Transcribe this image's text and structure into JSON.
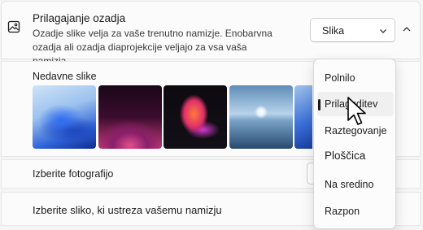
{
  "header": {
    "title": "Prilagajanje ozadja",
    "description": "Ozadje slike velja za vaše trenutno namizje. Enobarvna ozadja ali ozadja diaprojekcije veljajo za vsa vaša namizja.",
    "icon": "image-icon",
    "dropdown_value": "Slika",
    "dropdown_icon": "chevron-down-icon",
    "collapse_icon": "chevron-up-icon"
  },
  "recent": {
    "label": "Nedavne slike",
    "thumbnails": [
      "bloom-blue",
      "glow-pink",
      "abstract-flower",
      "moon-lake",
      "bloom-blue-partial"
    ]
  },
  "photo_row": {
    "label": "Izberite fotografijo"
  },
  "fit_row": {
    "label": "Izberite sliko, ki ustreza vašemu namizju"
  },
  "fit_menu": {
    "items": [
      "Polnilo",
      "Prilagoditev",
      "Raztegovanje",
      "Ploščica",
      "Na sredino",
      "Razpon"
    ],
    "selected": "Prilagoditev"
  },
  "colors": {
    "background": "#f3f3f3",
    "card": "#fbfbfb",
    "text": "#1b1b1b",
    "menu_selected": "#f0f0f0"
  }
}
